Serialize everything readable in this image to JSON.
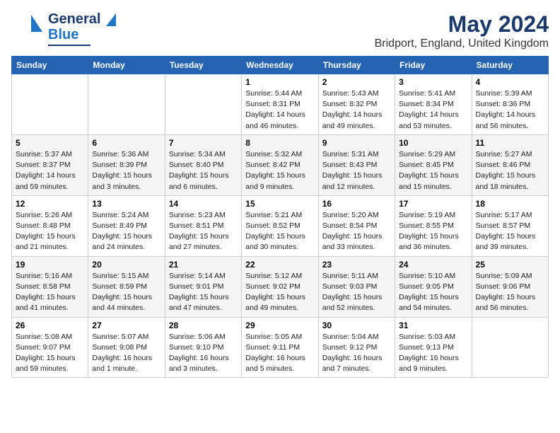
{
  "logo": {
    "line1": "General",
    "line2": "Blue"
  },
  "title": "May 2024",
  "subtitle": "Bridport, England, United Kingdom",
  "days_of_week": [
    "Sunday",
    "Monday",
    "Tuesday",
    "Wednesday",
    "Thursday",
    "Friday",
    "Saturday"
  ],
  "weeks": [
    [
      {
        "day": "",
        "info": ""
      },
      {
        "day": "",
        "info": ""
      },
      {
        "day": "",
        "info": ""
      },
      {
        "day": "1",
        "info": "Sunrise: 5:44 AM\nSunset: 8:31 PM\nDaylight: 14 hours\nand 46 minutes."
      },
      {
        "day": "2",
        "info": "Sunrise: 5:43 AM\nSunset: 8:32 PM\nDaylight: 14 hours\nand 49 minutes."
      },
      {
        "day": "3",
        "info": "Sunrise: 5:41 AM\nSunset: 8:34 PM\nDaylight: 14 hours\nand 53 minutes."
      },
      {
        "day": "4",
        "info": "Sunrise: 5:39 AM\nSunset: 8:36 PM\nDaylight: 14 hours\nand 56 minutes."
      }
    ],
    [
      {
        "day": "5",
        "info": "Sunrise: 5:37 AM\nSunset: 8:37 PM\nDaylight: 14 hours\nand 59 minutes."
      },
      {
        "day": "6",
        "info": "Sunrise: 5:36 AM\nSunset: 8:39 PM\nDaylight: 15 hours\nand 3 minutes."
      },
      {
        "day": "7",
        "info": "Sunrise: 5:34 AM\nSunset: 8:40 PM\nDaylight: 15 hours\nand 6 minutes."
      },
      {
        "day": "8",
        "info": "Sunrise: 5:32 AM\nSunset: 8:42 PM\nDaylight: 15 hours\nand 9 minutes."
      },
      {
        "day": "9",
        "info": "Sunrise: 5:31 AM\nSunset: 8:43 PM\nDaylight: 15 hours\nand 12 minutes."
      },
      {
        "day": "10",
        "info": "Sunrise: 5:29 AM\nSunset: 8:45 PM\nDaylight: 15 hours\nand 15 minutes."
      },
      {
        "day": "11",
        "info": "Sunrise: 5:27 AM\nSunset: 8:46 PM\nDaylight: 15 hours\nand 18 minutes."
      }
    ],
    [
      {
        "day": "12",
        "info": "Sunrise: 5:26 AM\nSunset: 8:48 PM\nDaylight: 15 hours\nand 21 minutes."
      },
      {
        "day": "13",
        "info": "Sunrise: 5:24 AM\nSunset: 8:49 PM\nDaylight: 15 hours\nand 24 minutes."
      },
      {
        "day": "14",
        "info": "Sunrise: 5:23 AM\nSunset: 8:51 PM\nDaylight: 15 hours\nand 27 minutes."
      },
      {
        "day": "15",
        "info": "Sunrise: 5:21 AM\nSunset: 8:52 PM\nDaylight: 15 hours\nand 30 minutes."
      },
      {
        "day": "16",
        "info": "Sunrise: 5:20 AM\nSunset: 8:54 PM\nDaylight: 15 hours\nand 33 minutes."
      },
      {
        "day": "17",
        "info": "Sunrise: 5:19 AM\nSunset: 8:55 PM\nDaylight: 15 hours\nand 36 minutes."
      },
      {
        "day": "18",
        "info": "Sunrise: 5:17 AM\nSunset: 8:57 PM\nDaylight: 15 hours\nand 39 minutes."
      }
    ],
    [
      {
        "day": "19",
        "info": "Sunrise: 5:16 AM\nSunset: 8:58 PM\nDaylight: 15 hours\nand 41 minutes."
      },
      {
        "day": "20",
        "info": "Sunrise: 5:15 AM\nSunset: 8:59 PM\nDaylight: 15 hours\nand 44 minutes."
      },
      {
        "day": "21",
        "info": "Sunrise: 5:14 AM\nSunset: 9:01 PM\nDaylight: 15 hours\nand 47 minutes."
      },
      {
        "day": "22",
        "info": "Sunrise: 5:12 AM\nSunset: 9:02 PM\nDaylight: 15 hours\nand 49 minutes."
      },
      {
        "day": "23",
        "info": "Sunrise: 5:11 AM\nSunset: 9:03 PM\nDaylight: 15 hours\nand 52 minutes."
      },
      {
        "day": "24",
        "info": "Sunrise: 5:10 AM\nSunset: 9:05 PM\nDaylight: 15 hours\nand 54 minutes."
      },
      {
        "day": "25",
        "info": "Sunrise: 5:09 AM\nSunset: 9:06 PM\nDaylight: 15 hours\nand 56 minutes."
      }
    ],
    [
      {
        "day": "26",
        "info": "Sunrise: 5:08 AM\nSunset: 9:07 PM\nDaylight: 15 hours\nand 59 minutes."
      },
      {
        "day": "27",
        "info": "Sunrise: 5:07 AM\nSunset: 9:08 PM\nDaylight: 16 hours\nand 1 minute."
      },
      {
        "day": "28",
        "info": "Sunrise: 5:06 AM\nSunset: 9:10 PM\nDaylight: 16 hours\nand 3 minutes."
      },
      {
        "day": "29",
        "info": "Sunrise: 5:05 AM\nSunset: 9:11 PM\nDaylight: 16 hours\nand 5 minutes."
      },
      {
        "day": "30",
        "info": "Sunrise: 5:04 AM\nSunset: 9:12 PM\nDaylight: 16 hours\nand 7 minutes."
      },
      {
        "day": "31",
        "info": "Sunrise: 5:03 AM\nSunset: 9:13 PM\nDaylight: 16 hours\nand 9 minutes."
      },
      {
        "day": "",
        "info": ""
      }
    ]
  ]
}
